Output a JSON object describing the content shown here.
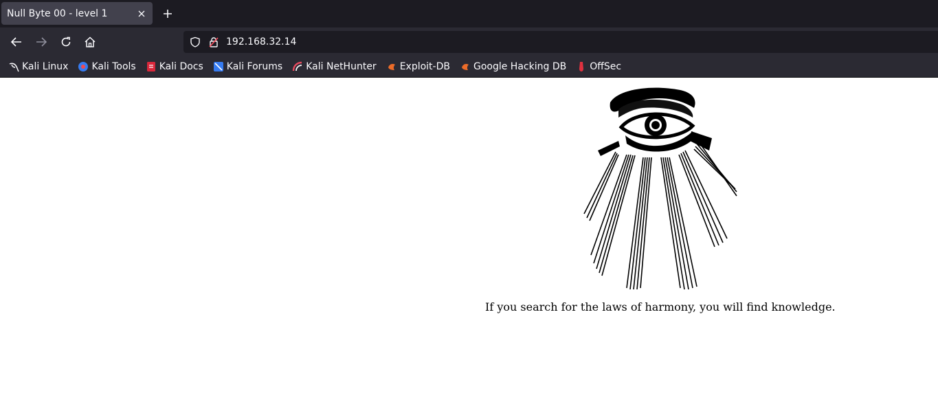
{
  "tabs": [
    {
      "title": "Null Byte 00 - level 1"
    }
  ],
  "toolbar": {
    "url": "192.168.32.14"
  },
  "bookmarks": [
    {
      "label": "Kali Linux",
      "icon": "kali-dragon-icon"
    },
    {
      "label": "Kali Tools",
      "icon": "kali-tools-icon"
    },
    {
      "label": "Kali Docs",
      "icon": "kali-docs-icon"
    },
    {
      "label": "Kali Forums",
      "icon": "kali-forums-icon"
    },
    {
      "label": "Kali NetHunter",
      "icon": "kali-nethunter-icon"
    },
    {
      "label": "Exploit-DB",
      "icon": "exploit-db-icon"
    },
    {
      "label": "Google Hacking DB",
      "icon": "exploit-db-icon"
    },
    {
      "label": "OffSec",
      "icon": "offsec-icon"
    }
  ],
  "page": {
    "text": "If you search for the laws of harmony, you will find knowledge."
  }
}
